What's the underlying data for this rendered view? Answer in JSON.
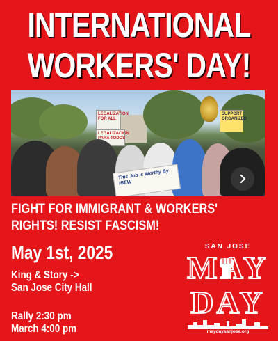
{
  "poster": {
    "title_line1": "INTERNATIONAL",
    "title_line2": "WORKERS' DAY!",
    "photo": {
      "signs": [
        "LEGALIZATION FOR ALL",
        "LEGALIZACION PARA TODOS",
        "SUPPORT ORGANIZED"
      ],
      "banner_text": "This Job is Worthy\nBy IBEW",
      "next_icon": "chevron-right-icon"
    },
    "subhead_line1": "FIGHT FOR IMMIGRANT & WORKERS'",
    "subhead_line2": "RIGHTS! RESIST FASCISM!",
    "date": "May 1st, 2025",
    "location_line1": "King & Story ->",
    "location_line2": "San Jose City Hall",
    "rally_time": "Rally 2:30 pm",
    "march_time": "March 4:00 pm",
    "logo": {
      "city": "SAN JOSE",
      "word1": "MAY",
      "word2": "DAY",
      "url": "maydaysanjose.org",
      "icon": "raised-fist-icon"
    },
    "colors": {
      "background": "#e4161a",
      "text": "#ffffff"
    }
  }
}
